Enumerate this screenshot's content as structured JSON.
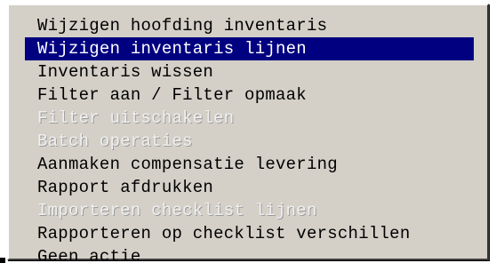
{
  "menu": {
    "items": [
      {
        "label": "Wijzigen hoofding inventaris",
        "state": "normal"
      },
      {
        "label": "Wijzigen inventaris lijnen",
        "state": "selected"
      },
      {
        "label": "Inventaris wissen",
        "state": "normal"
      },
      {
        "label": "Filter aan / Filter opmaak",
        "state": "normal"
      },
      {
        "label": "Filter uitschakelen",
        "state": "disabled"
      },
      {
        "label": "Batch operaties",
        "state": "disabled"
      },
      {
        "label": "Aanmaken compensatie levering",
        "state": "normal"
      },
      {
        "label": "Rapport afdrukken",
        "state": "normal"
      },
      {
        "label": "Importeren checklist lijnen",
        "state": "disabled"
      },
      {
        "label": "Rapporteren op checklist verschillen",
        "state": "normal"
      },
      {
        "label": "Geen actie",
        "state": "normal"
      }
    ]
  },
  "colors": {
    "panel_background": "#d4d0c8",
    "selection_background": "#000080",
    "selection_text": "#ffffff",
    "normal_text": "#000000",
    "disabled_text": "#f0f0f0"
  }
}
